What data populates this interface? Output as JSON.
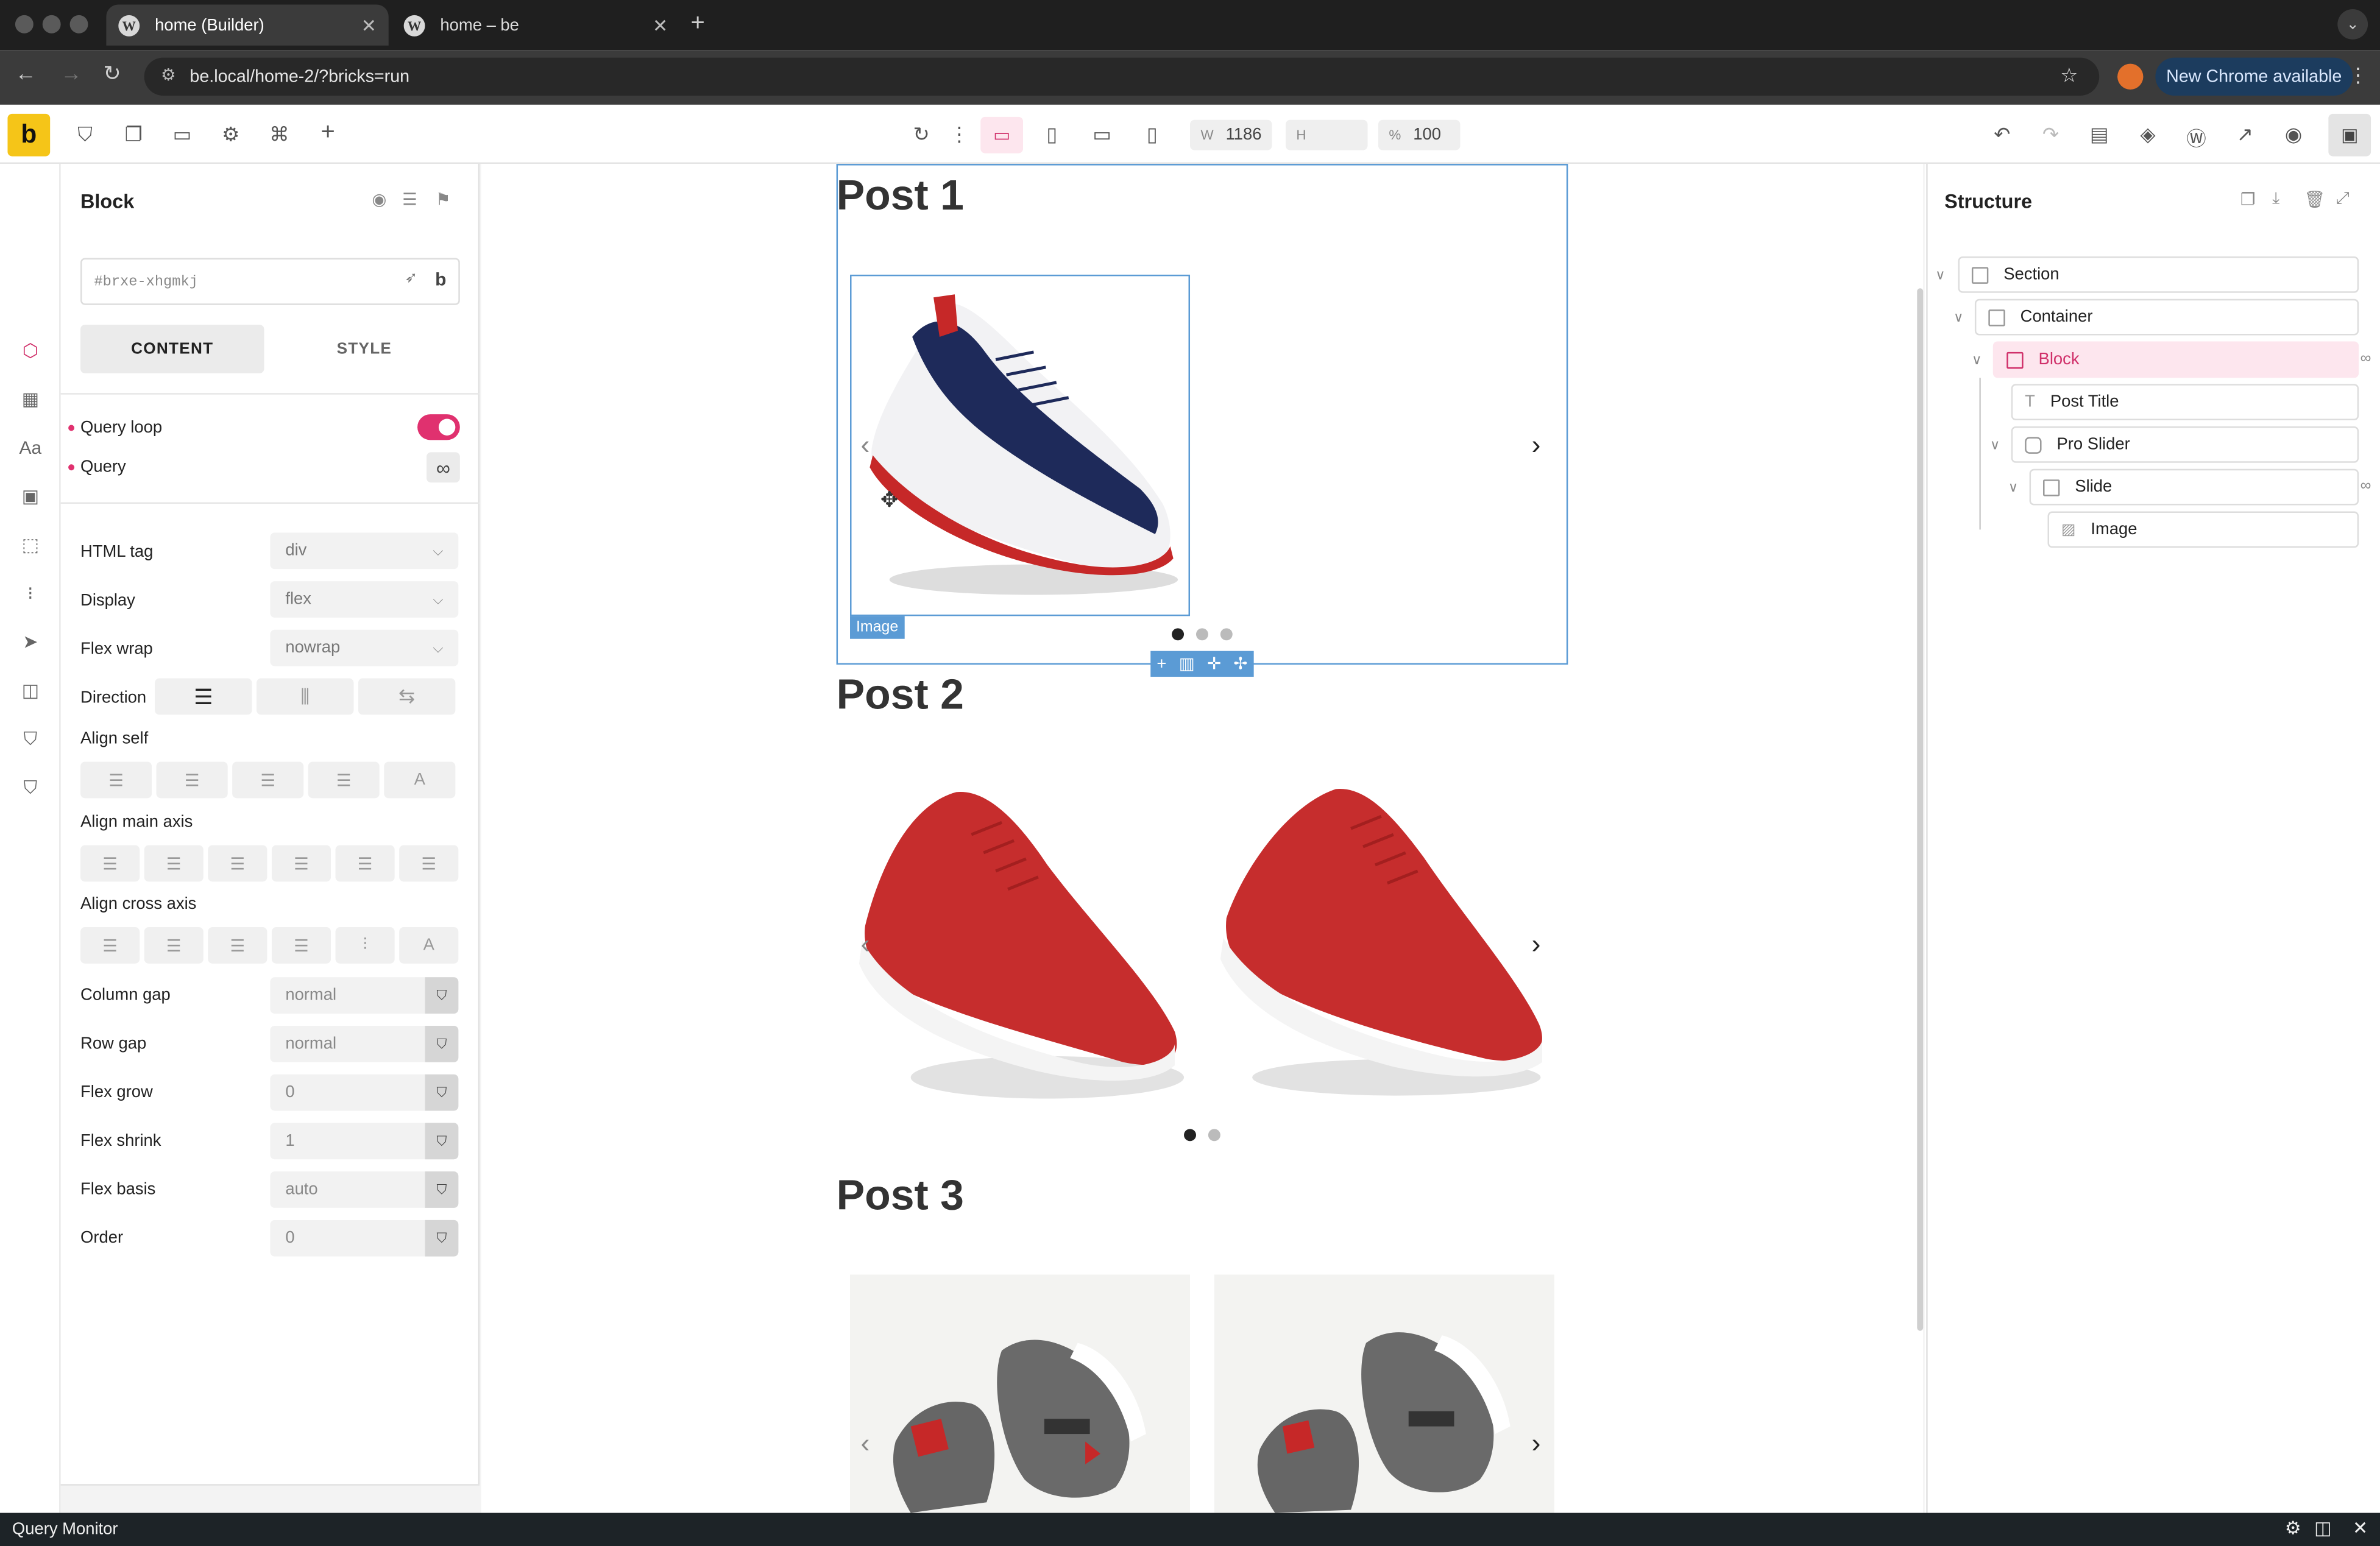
{
  "browser": {
    "tabs": [
      {
        "label": "home (Builder)",
        "close": "✕"
      },
      {
        "label": "home – be",
        "close": "✕"
      }
    ],
    "new_tab": "+",
    "url": "be.local/home-2/?bricks=run",
    "new_chrome": "New Chrome available"
  },
  "toolbar": {
    "logo": "b",
    "width_label": "W",
    "width_value": "1186",
    "height_label": "H",
    "height_value": "",
    "zoom_label": "%",
    "zoom_value": "100"
  },
  "panel": {
    "title": "Block",
    "css_id": "#brxe-xhgmkj",
    "css_btn": "b",
    "tab_content": "CONTENT",
    "tab_style": "STYLE",
    "query_loop": "Query loop",
    "query": "Query",
    "query_icon": "∞",
    "fields": {
      "html_tag": {
        "label": "HTML tag",
        "value": "div"
      },
      "display": {
        "label": "Display",
        "value": "flex"
      },
      "flex_wrap": {
        "label": "Flex wrap",
        "value": "nowrap"
      },
      "direction": {
        "label": "Direction"
      },
      "align_self": {
        "label": "Align self"
      },
      "align_main": {
        "label": "Align main axis"
      },
      "align_cross": {
        "label": "Align cross axis"
      },
      "column_gap": {
        "label": "Column gap",
        "value": "normal"
      },
      "row_gap": {
        "label": "Row gap",
        "value": "normal"
      },
      "flex_grow": {
        "label": "Flex grow",
        "value": "0"
      },
      "flex_shrink": {
        "label": "Flex shrink",
        "value": "1"
      },
      "flex_basis": {
        "label": "Flex basis",
        "value": "auto"
      },
      "order": {
        "label": "Order",
        "value": "0"
      }
    }
  },
  "canvas": {
    "posts": [
      {
        "title": "Post 1"
      },
      {
        "title": "Post 2"
      },
      {
        "title": "Post 3"
      }
    ],
    "image_tag": "Image",
    "prev": "‹",
    "next": "›"
  },
  "structure": {
    "title": "Structure",
    "nodes": [
      {
        "label": "Section"
      },
      {
        "label": "Container"
      },
      {
        "label": "Block"
      },
      {
        "label": "Post Title"
      },
      {
        "label": "Pro Slider"
      },
      {
        "label": "Slide"
      },
      {
        "label": "Image"
      }
    ]
  },
  "footer": {
    "label": "Query Monitor"
  },
  "colors": {
    "accent": "#e0316f",
    "brand": "#f5c518",
    "select_blue": "#5b9bd5"
  }
}
